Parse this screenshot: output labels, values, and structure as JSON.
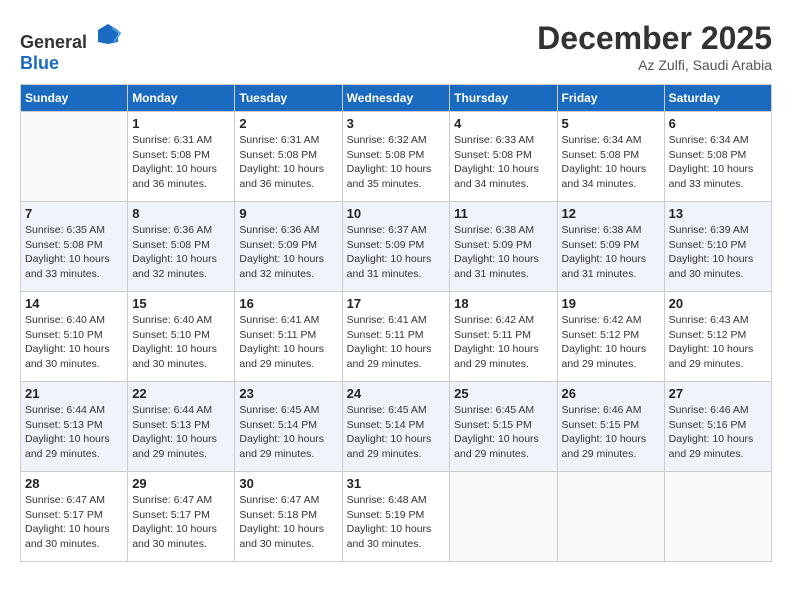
{
  "header": {
    "logo_general": "General",
    "logo_blue": "Blue",
    "month_year": "December 2025",
    "location": "Az Zulfi, Saudi Arabia"
  },
  "weekdays": [
    "Sunday",
    "Monday",
    "Tuesday",
    "Wednesday",
    "Thursday",
    "Friday",
    "Saturday"
  ],
  "weeks": [
    [
      {
        "day": "",
        "sunrise": "",
        "sunset": "",
        "daylight": ""
      },
      {
        "day": "1",
        "sunrise": "Sunrise: 6:31 AM",
        "sunset": "Sunset: 5:08 PM",
        "daylight": "Daylight: 10 hours and 36 minutes."
      },
      {
        "day": "2",
        "sunrise": "Sunrise: 6:31 AM",
        "sunset": "Sunset: 5:08 PM",
        "daylight": "Daylight: 10 hours and 36 minutes."
      },
      {
        "day": "3",
        "sunrise": "Sunrise: 6:32 AM",
        "sunset": "Sunset: 5:08 PM",
        "daylight": "Daylight: 10 hours and 35 minutes."
      },
      {
        "day": "4",
        "sunrise": "Sunrise: 6:33 AM",
        "sunset": "Sunset: 5:08 PM",
        "daylight": "Daylight: 10 hours and 34 minutes."
      },
      {
        "day": "5",
        "sunrise": "Sunrise: 6:34 AM",
        "sunset": "Sunset: 5:08 PM",
        "daylight": "Daylight: 10 hours and 34 minutes."
      },
      {
        "day": "6",
        "sunrise": "Sunrise: 6:34 AM",
        "sunset": "Sunset: 5:08 PM",
        "daylight": "Daylight: 10 hours and 33 minutes."
      }
    ],
    [
      {
        "day": "7",
        "sunrise": "Sunrise: 6:35 AM",
        "sunset": "Sunset: 5:08 PM",
        "daylight": "Daylight: 10 hours and 33 minutes."
      },
      {
        "day": "8",
        "sunrise": "Sunrise: 6:36 AM",
        "sunset": "Sunset: 5:08 PM",
        "daylight": "Daylight: 10 hours and 32 minutes."
      },
      {
        "day": "9",
        "sunrise": "Sunrise: 6:36 AM",
        "sunset": "Sunset: 5:09 PM",
        "daylight": "Daylight: 10 hours and 32 minutes."
      },
      {
        "day": "10",
        "sunrise": "Sunrise: 6:37 AM",
        "sunset": "Sunset: 5:09 PM",
        "daylight": "Daylight: 10 hours and 31 minutes."
      },
      {
        "day": "11",
        "sunrise": "Sunrise: 6:38 AM",
        "sunset": "Sunset: 5:09 PM",
        "daylight": "Daylight: 10 hours and 31 minutes."
      },
      {
        "day": "12",
        "sunrise": "Sunrise: 6:38 AM",
        "sunset": "Sunset: 5:09 PM",
        "daylight": "Daylight: 10 hours and 31 minutes."
      },
      {
        "day": "13",
        "sunrise": "Sunrise: 6:39 AM",
        "sunset": "Sunset: 5:10 PM",
        "daylight": "Daylight: 10 hours and 30 minutes."
      }
    ],
    [
      {
        "day": "14",
        "sunrise": "Sunrise: 6:40 AM",
        "sunset": "Sunset: 5:10 PM",
        "daylight": "Daylight: 10 hours and 30 minutes."
      },
      {
        "day": "15",
        "sunrise": "Sunrise: 6:40 AM",
        "sunset": "Sunset: 5:10 PM",
        "daylight": "Daylight: 10 hours and 30 minutes."
      },
      {
        "day": "16",
        "sunrise": "Sunrise: 6:41 AM",
        "sunset": "Sunset: 5:11 PM",
        "daylight": "Daylight: 10 hours and 29 minutes."
      },
      {
        "day": "17",
        "sunrise": "Sunrise: 6:41 AM",
        "sunset": "Sunset: 5:11 PM",
        "daylight": "Daylight: 10 hours and 29 minutes."
      },
      {
        "day": "18",
        "sunrise": "Sunrise: 6:42 AM",
        "sunset": "Sunset: 5:11 PM",
        "daylight": "Daylight: 10 hours and 29 minutes."
      },
      {
        "day": "19",
        "sunrise": "Sunrise: 6:42 AM",
        "sunset": "Sunset: 5:12 PM",
        "daylight": "Daylight: 10 hours and 29 minutes."
      },
      {
        "day": "20",
        "sunrise": "Sunrise: 6:43 AM",
        "sunset": "Sunset: 5:12 PM",
        "daylight": "Daylight: 10 hours and 29 minutes."
      }
    ],
    [
      {
        "day": "21",
        "sunrise": "Sunrise: 6:44 AM",
        "sunset": "Sunset: 5:13 PM",
        "daylight": "Daylight: 10 hours and 29 minutes."
      },
      {
        "day": "22",
        "sunrise": "Sunrise: 6:44 AM",
        "sunset": "Sunset: 5:13 PM",
        "daylight": "Daylight: 10 hours and 29 minutes."
      },
      {
        "day": "23",
        "sunrise": "Sunrise: 6:45 AM",
        "sunset": "Sunset: 5:14 PM",
        "daylight": "Daylight: 10 hours and 29 minutes."
      },
      {
        "day": "24",
        "sunrise": "Sunrise: 6:45 AM",
        "sunset": "Sunset: 5:14 PM",
        "daylight": "Daylight: 10 hours and 29 minutes."
      },
      {
        "day": "25",
        "sunrise": "Sunrise: 6:45 AM",
        "sunset": "Sunset: 5:15 PM",
        "daylight": "Daylight: 10 hours and 29 minutes."
      },
      {
        "day": "26",
        "sunrise": "Sunrise: 6:46 AM",
        "sunset": "Sunset: 5:15 PM",
        "daylight": "Daylight: 10 hours and 29 minutes."
      },
      {
        "day": "27",
        "sunrise": "Sunrise: 6:46 AM",
        "sunset": "Sunset: 5:16 PM",
        "daylight": "Daylight: 10 hours and 29 minutes."
      }
    ],
    [
      {
        "day": "28",
        "sunrise": "Sunrise: 6:47 AM",
        "sunset": "Sunset: 5:17 PM",
        "daylight": "Daylight: 10 hours and 30 minutes."
      },
      {
        "day": "29",
        "sunrise": "Sunrise: 6:47 AM",
        "sunset": "Sunset: 5:17 PM",
        "daylight": "Daylight: 10 hours and 30 minutes."
      },
      {
        "day": "30",
        "sunrise": "Sunrise: 6:47 AM",
        "sunset": "Sunset: 5:18 PM",
        "daylight": "Daylight: 10 hours and 30 minutes."
      },
      {
        "day": "31",
        "sunrise": "Sunrise: 6:48 AM",
        "sunset": "Sunset: 5:19 PM",
        "daylight": "Daylight: 10 hours and 30 minutes."
      },
      {
        "day": "",
        "sunrise": "",
        "sunset": "",
        "daylight": ""
      },
      {
        "day": "",
        "sunrise": "",
        "sunset": "",
        "daylight": ""
      },
      {
        "day": "",
        "sunrise": "",
        "sunset": "",
        "daylight": ""
      }
    ]
  ]
}
